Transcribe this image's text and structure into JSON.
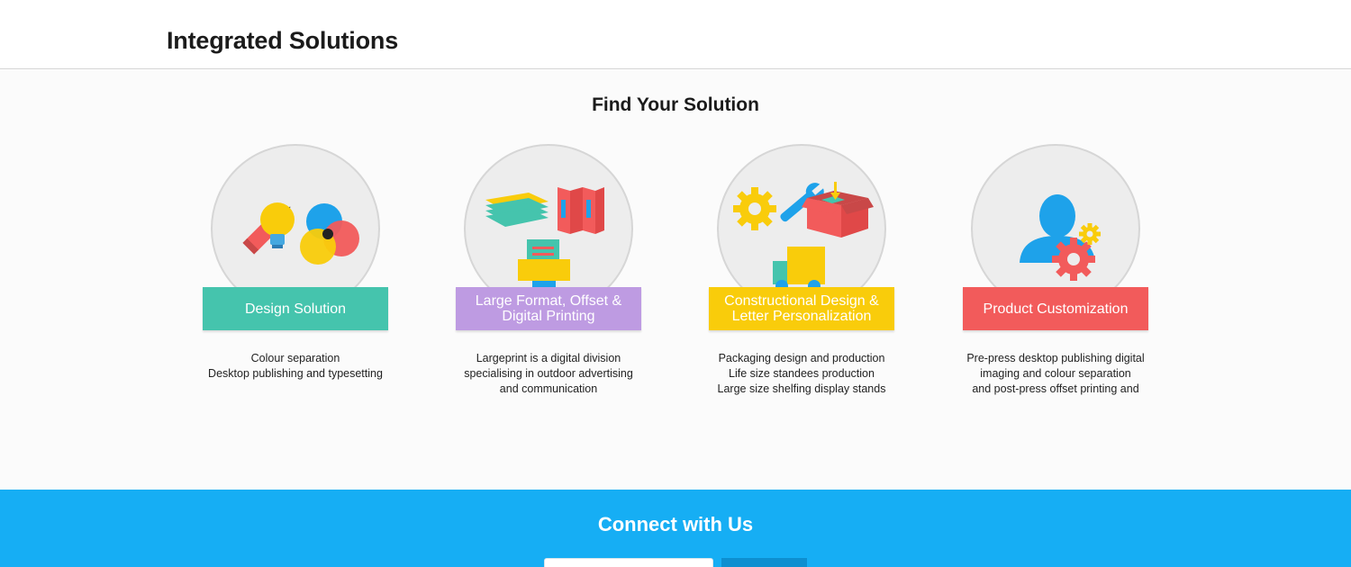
{
  "header": {
    "title": "Integrated Solutions"
  },
  "main": {
    "title": "Find Your Solution",
    "cards": [
      {
        "label": "Design Solution",
        "color": "#45c4ad",
        "icon": "design-tools-icon",
        "lines": [
          "Colour separation",
          "Desktop publishing and typesetting"
        ]
      },
      {
        "label": "Large Format, Offset & Digital Printing",
        "color": "#be9be2",
        "icon": "printing-icon",
        "lines": [
          "Largeprint is a digital division",
          "specialising in outdoor advertising",
          "and communication"
        ]
      },
      {
        "label": "Constructional Design & Letter Personalization",
        "color": "#f9cc0b",
        "icon": "construction-delivery-icon",
        "lines": [
          "Packaging design and production",
          "Life size standees production",
          "Large size shelfing display stands"
        ]
      },
      {
        "label": "Product Customization",
        "color": "#f25b5b",
        "icon": "user-gears-icon",
        "lines": [
          "Pre-press desktop publishing digital",
          "imaging and colour separation",
          "and post-press offset printing and"
        ]
      }
    ]
  },
  "footer": {
    "title": "Connect with Us",
    "email_placeholder": "",
    "submit_label": ""
  }
}
